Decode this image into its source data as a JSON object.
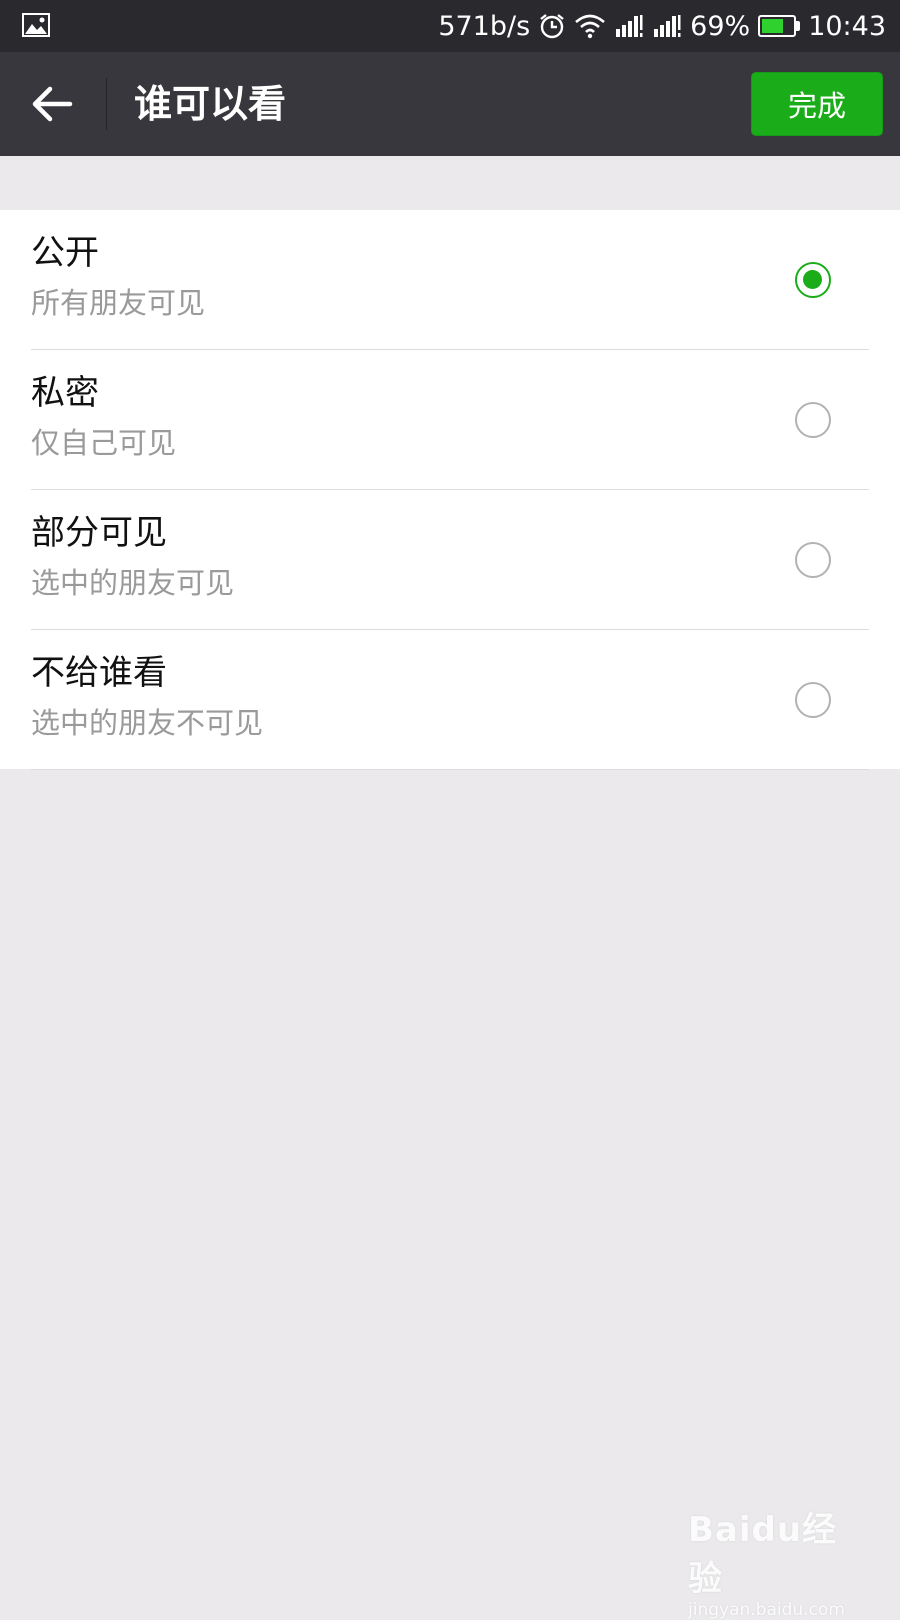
{
  "status_bar": {
    "speed": "571b/s",
    "battery_percent": "69%",
    "battery_level": 0.69,
    "time": "10:43",
    "icons": [
      "image-icon",
      "alarm-icon",
      "wifi-icon",
      "signal-icon",
      "signal-icon",
      "battery-icon"
    ]
  },
  "header": {
    "title": "谁可以看",
    "done_label": "完成"
  },
  "options": [
    {
      "label": "公开",
      "desc": "所有朋友可见",
      "selected": true
    },
    {
      "label": "私密",
      "desc": "仅自己可见",
      "selected": false
    },
    {
      "label": "部分可见",
      "desc": "选中的朋友可见",
      "selected": false
    },
    {
      "label": "不给谁看",
      "desc": "选中的朋友不可见",
      "selected": false
    }
  ],
  "colors": {
    "accent": "#1aad19",
    "header_bg": "#38373d",
    "status_bg": "#2a292e",
    "page_bg": "#ebe9ec"
  },
  "watermark": {
    "brand": "Baidu经验",
    "url": "jingyan.baidu.com"
  }
}
